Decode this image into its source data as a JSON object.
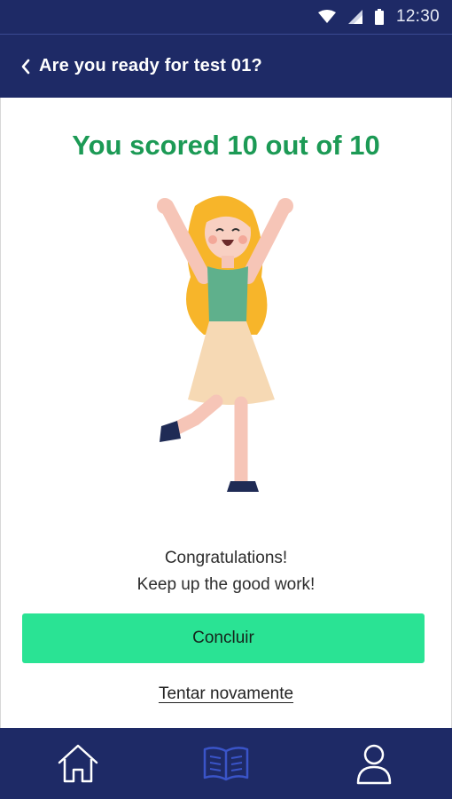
{
  "status_bar": {
    "time": "12:30",
    "icons": [
      "wifi-icon",
      "signal-icon",
      "battery-icon"
    ]
  },
  "header": {
    "title": "Are you ready for test 01?",
    "back_icon": "chevron-left-icon"
  },
  "result": {
    "score_text": "You scored 10 out of 10",
    "message_line1": "Congratulations!",
    "message_line2": "Keep up the good work!"
  },
  "actions": {
    "primary_label": "Concluir",
    "secondary_label": "Tentar novamente"
  },
  "bottom_nav": {
    "items": [
      {
        "icon": "home-icon",
        "active": false
      },
      {
        "icon": "book-icon",
        "active": true
      },
      {
        "icon": "user-icon",
        "active": false
      }
    ]
  },
  "colors": {
    "header_bg": "#1e2a66",
    "score_green": "#1c9a55",
    "button_green": "#2ae394",
    "nav_active": "#3a54c8"
  }
}
